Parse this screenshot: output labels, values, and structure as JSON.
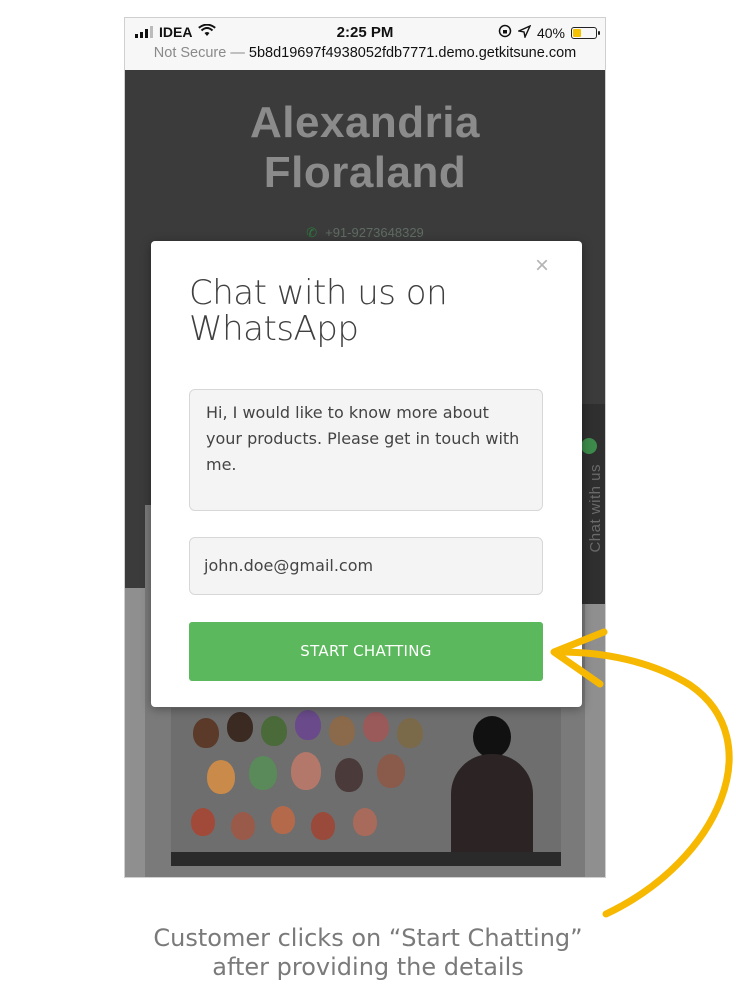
{
  "statusbar": {
    "carrier": "IDEA",
    "time": "2:25 PM",
    "battery": "40%",
    "battery_level": 0.4
  },
  "urlbar": {
    "not_secure": "Not Secure —",
    "host": "5b8d19697f4938052fdb7771.demo.getkitsune.com"
  },
  "site": {
    "brand_line1": "Alexandria",
    "brand_line2": "Floraland",
    "phone": "+91-9273648329",
    "side_tab": "Chat with us"
  },
  "modal": {
    "title": "Chat with us on WhatsApp",
    "close": "×",
    "message": "Hi, I would like to know more about your products. Please get in touch with me.",
    "email": "john.doe@gmail.com",
    "button": "START CHATTING"
  },
  "caption": {
    "line1": "Customer clicks on “Start Chatting”",
    "line2": "after providing the details"
  },
  "colors": {
    "accent_green": "#5cb85c",
    "arrow_yellow": "#f6b800"
  },
  "icons": {
    "wifi": "wifi-icon",
    "phone": "phone-icon",
    "location": "location-arrow-icon",
    "lock_rotation": "rotation-lock-icon",
    "whatsapp": "whatsapp-icon"
  }
}
